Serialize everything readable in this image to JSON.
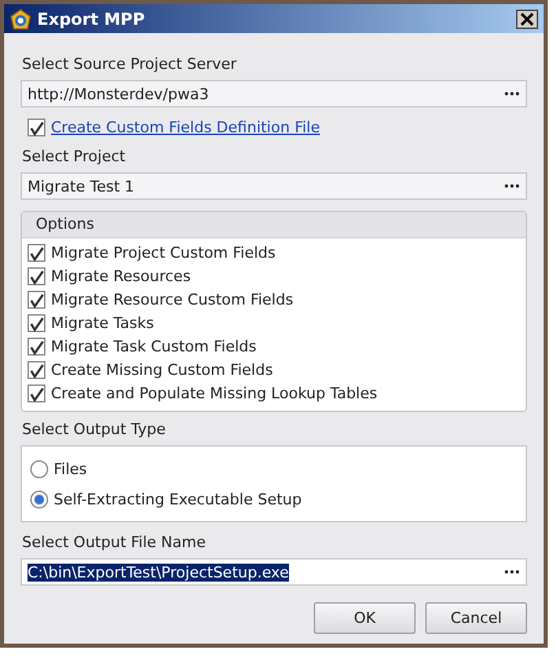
{
  "window": {
    "title": "Export MPP"
  },
  "source_server": {
    "label": "Select Source Project Server",
    "value": "http://Monsterdev/pwa3"
  },
  "definition_file": {
    "label": "Create Custom Fields Definition File",
    "checked": true
  },
  "project": {
    "label": "Select Project",
    "value": "Migrate Test 1"
  },
  "options": {
    "title": "Options",
    "items": [
      {
        "label": "Migrate Project Custom Fields",
        "checked": true
      },
      {
        "label": "Migrate Resources",
        "checked": true
      },
      {
        "label": "Migrate Resource Custom Fields",
        "checked": true
      },
      {
        "label": "Migrate Tasks",
        "checked": true
      },
      {
        "label": "Migrate Task Custom Fields",
        "checked": true
      },
      {
        "label": "Create Missing Custom Fields",
        "checked": true
      },
      {
        "label": "Create and Populate Missing Lookup Tables",
        "checked": true
      }
    ]
  },
  "output_type": {
    "label": "Select Output Type",
    "items": [
      {
        "label": "Files",
        "selected": false
      },
      {
        "label": "Self-Extracting Executable Setup",
        "selected": true
      }
    ]
  },
  "output_file": {
    "label": "Select Output File Name",
    "value": "C:\\bin\\ExportTest\\ProjectSetup.exe",
    "highlighted": true
  },
  "buttons": [
    {
      "label": "OK"
    },
    {
      "label": "Cancel"
    }
  ]
}
